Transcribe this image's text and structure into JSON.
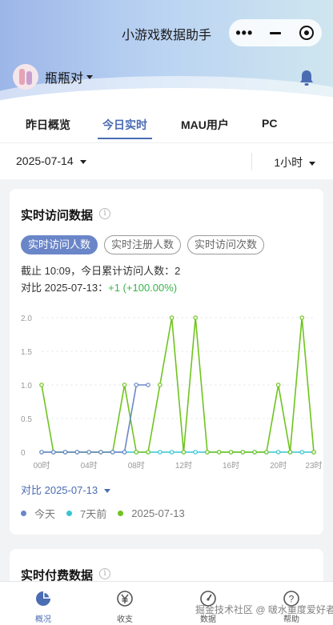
{
  "app": {
    "title": "小游戏数据助手"
  },
  "user": {
    "name": "瓶瓶对"
  },
  "tabs": [
    {
      "label": "昨日概览"
    },
    {
      "label": "今日实时"
    },
    {
      "label": "MAU用户"
    },
    {
      "label": "PC"
    }
  ],
  "filter": {
    "date": "2025-07-14",
    "interval": "1小时"
  },
  "card": {
    "title": "实时访问数据",
    "info_glyph": "i",
    "pills": [
      "实时访问人数",
      "实时注册人数",
      "实时访问次数"
    ],
    "summary_line1": "截止 10:09，今日累计访问人数：2",
    "summary_line2_prefix": "对比 2025-07-13：",
    "summary_line2_delta": "+1 (+100.00%)",
    "compare_label": "对比 2025-07-13",
    "legend": [
      "今天",
      "7天前",
      "2025-07-13"
    ]
  },
  "card2": {
    "title": "实时付费数据"
  },
  "nav": [
    {
      "label": "概况",
      "icon": "pie-chart-icon"
    },
    {
      "label": "收支",
      "icon": "yen-icon"
    },
    {
      "label": "数据",
      "icon": "gauge-icon"
    },
    {
      "label": "帮助",
      "icon": "help-icon"
    }
  ],
  "watermark": "掘金技术社区 @ 啵水重度爱好者",
  "colors": {
    "today": "#6a86c8",
    "week_ago": "#36c5d0",
    "yesterday": "#6fc41e",
    "accent": "#4a6cb3"
  },
  "chart_data": {
    "type": "line",
    "x": [
      "00时",
      "01时",
      "02时",
      "03时",
      "04时",
      "05时",
      "06时",
      "07时",
      "08时",
      "09时",
      "10时",
      "11时",
      "12时",
      "13时",
      "14时",
      "15时",
      "16时",
      "17时",
      "18时",
      "19时",
      "20时",
      "21时",
      "22时",
      "23时"
    ],
    "x_tick_labels": [
      "00时",
      "04时",
      "08时",
      "12时",
      "16时",
      "20时",
      "23时"
    ],
    "y_tick_labels": [
      "0",
      "0.5",
      "1.0",
      "1.5",
      "2.0"
    ],
    "ylim": [
      0,
      2
    ],
    "series": [
      {
        "name": "今天",
        "values": [
          0,
          0,
          0,
          0,
          0,
          0,
          0,
          0,
          1,
          1,
          null,
          null,
          null,
          null,
          null,
          null,
          null,
          null,
          null,
          null,
          null,
          null,
          null,
          null
        ]
      },
      {
        "name": "7天前",
        "values": [
          0,
          0,
          0,
          0,
          0,
          0,
          0,
          0,
          0,
          0,
          0,
          0,
          0,
          0,
          0,
          0,
          0,
          0,
          0,
          0,
          0,
          0,
          0,
          0
        ]
      },
      {
        "name": "2025-07-13",
        "values": [
          1,
          0,
          0,
          0,
          0,
          0,
          0,
          1,
          0,
          0,
          1,
          2,
          0,
          2,
          0,
          0,
          0,
          0,
          0,
          0,
          1,
          0,
          2,
          0
        ]
      }
    ]
  }
}
